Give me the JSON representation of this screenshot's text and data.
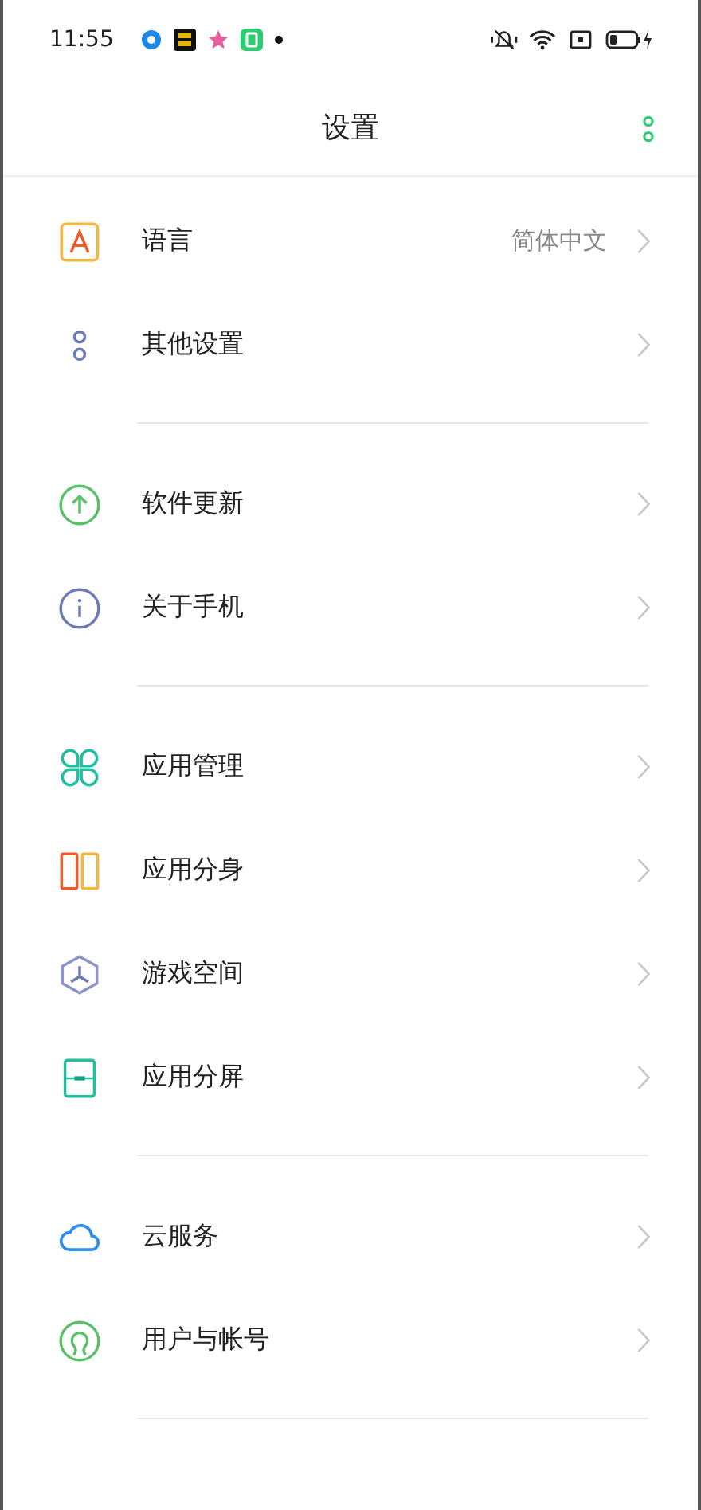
{
  "status_bar": {
    "time": "11:55"
  },
  "header": {
    "title": "设置"
  },
  "groups": [
    {
      "items": [
        {
          "kind": "language",
          "label": "语言",
          "value": "简体中文"
        },
        {
          "kind": "other",
          "label": "其他设置"
        }
      ]
    },
    {
      "items": [
        {
          "kind": "update",
          "label": "软件更新"
        },
        {
          "kind": "about",
          "label": "关于手机"
        }
      ]
    },
    {
      "items": [
        {
          "kind": "apps",
          "label": "应用管理"
        },
        {
          "kind": "clone",
          "label": "应用分身"
        },
        {
          "kind": "game",
          "label": "游戏空间"
        },
        {
          "kind": "split",
          "label": "应用分屏"
        }
      ]
    },
    {
      "items": [
        {
          "kind": "cloud",
          "label": "云服务"
        },
        {
          "kind": "user",
          "label": "用户与帐号"
        }
      ]
    }
  ]
}
